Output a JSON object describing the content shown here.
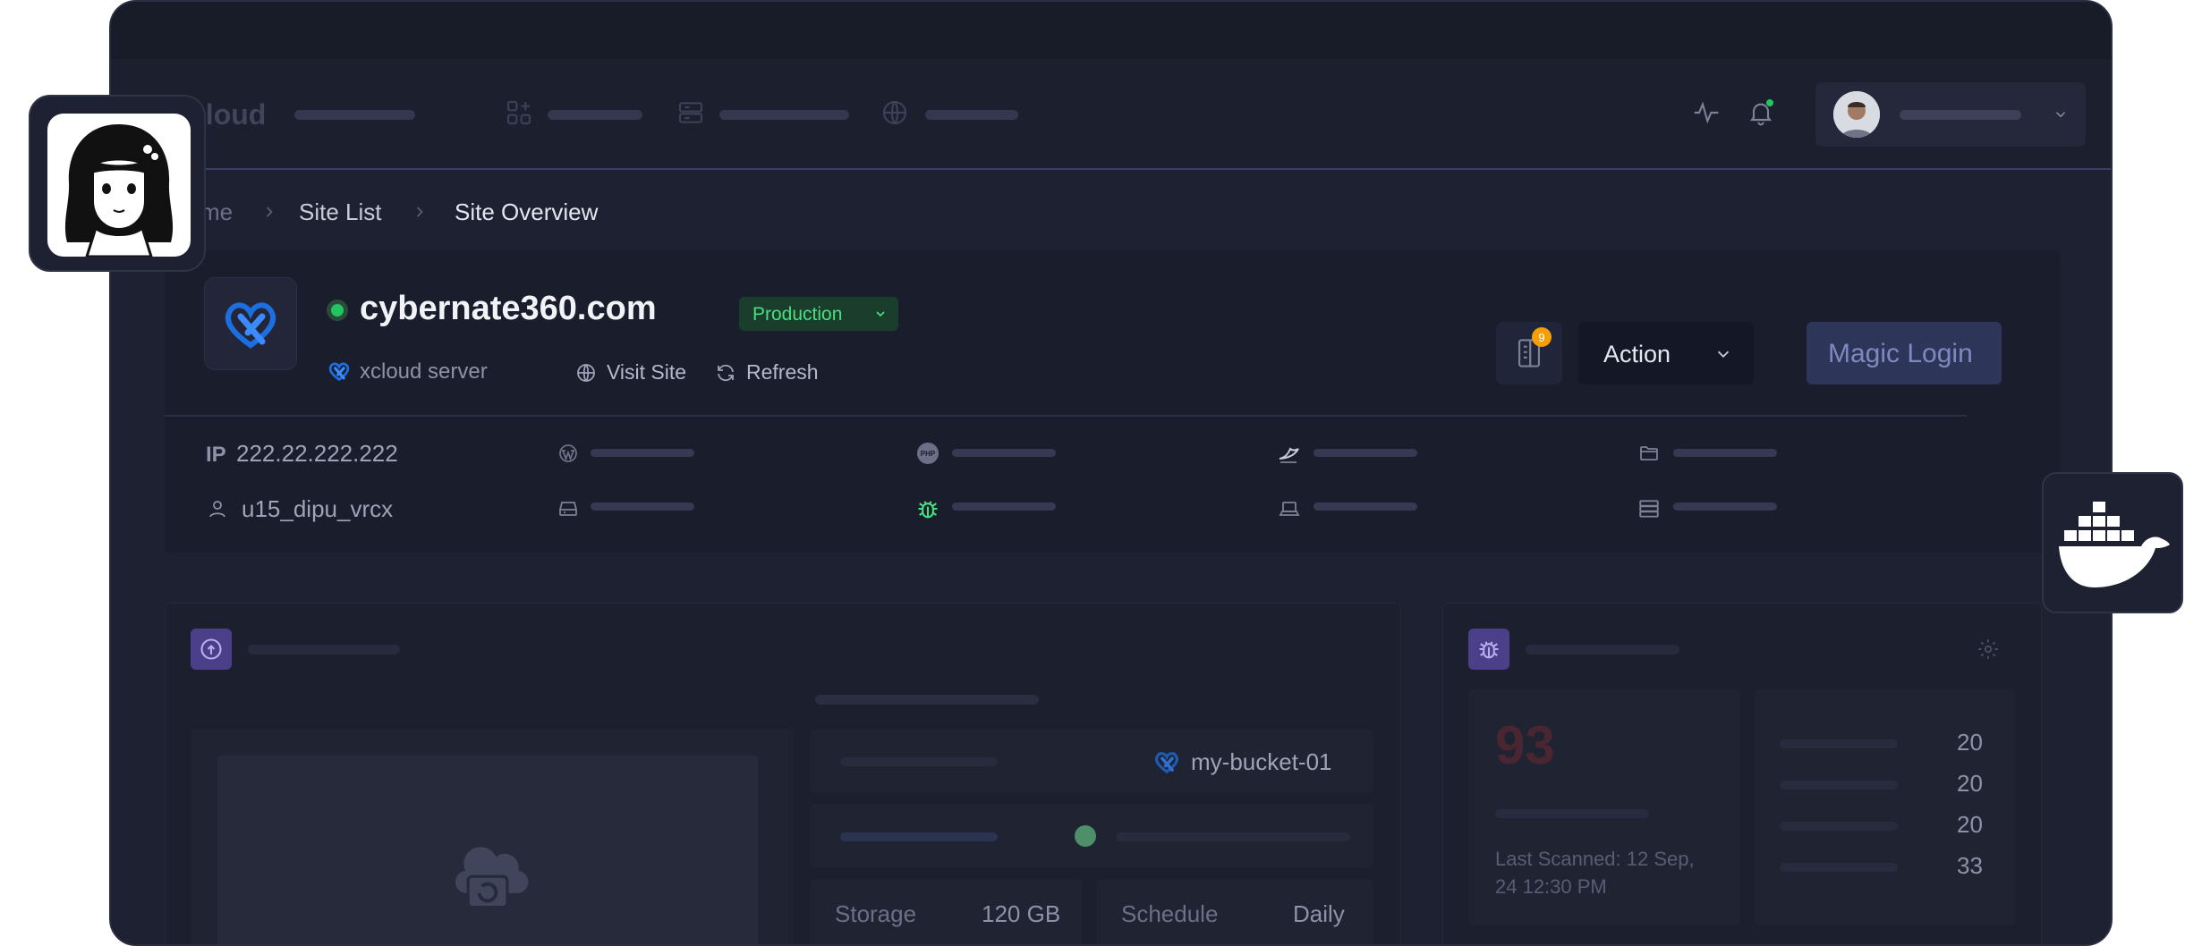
{
  "header": {
    "brand": "cloud",
    "user_avatar_alt": "user avatar"
  },
  "breadcrumb": {
    "items": [
      "me",
      "Site List",
      "Site Overview"
    ]
  },
  "site": {
    "domain": "cybernate360.com",
    "environment": "Production",
    "server_label": "xcloud server",
    "visit_label": "Visit Site",
    "refresh_label": "Refresh",
    "notes_badge": "9",
    "action_label": "Action",
    "magic_login_label": "Magic Login",
    "ip_prefix": "IP",
    "ip": "222.22.222.222",
    "username": "u15_dipu_vrcx"
  },
  "backup": {
    "bucket": "my-bucket-01",
    "storage_label": "Storage",
    "storage_value": "120 GB",
    "schedule_label": "Schedule",
    "schedule_value": "Daily"
  },
  "security": {
    "score": "93",
    "last_scanned": "Last Scanned: 12 Sep, 24 12:30 PM",
    "counts": [
      "20",
      "20",
      "20",
      "33"
    ]
  },
  "colors": {
    "page_bg": "#ffffff",
    "window_bg": "#1e2131",
    "accent_green": "#22c55e",
    "production_text": "#4ade80",
    "magic_login_bg": "#2d3558",
    "badge_orange": "#f59e0b"
  }
}
